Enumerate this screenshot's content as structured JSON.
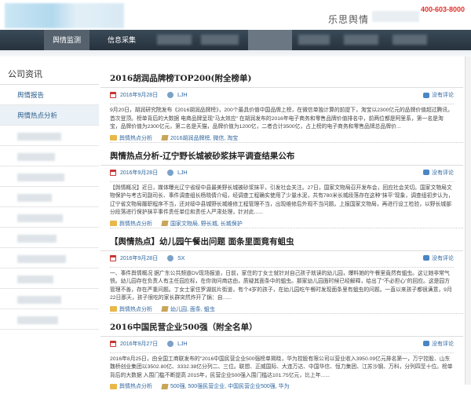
{
  "header": {
    "phone": "400-603-8000",
    "brand": "乐思舆情"
  },
  "nav": {
    "items": [
      {
        "label": "舆情监测"
      },
      {
        "label": "信息采集"
      }
    ]
  },
  "sidebar": {
    "title": "公司资讯",
    "items": [
      {
        "label": "舆情报告"
      },
      {
        "label": "舆情热点分析"
      }
    ]
  },
  "articles": [
    {
      "title": "2016胡润品牌榜TOP200(附全榜单)",
      "date": "2016年9月28日",
      "author": "LJH",
      "comments": "没有评论",
      "summary": "9月20日，胡润研究院发布《2016胡润品牌榜》，200个最具价值中国品牌上榜，在微信单独计算的前提下，淘宝以2300亿元的品牌价值超过腾讯，首次登顶。榜单背后的大数据 电商品牌呈现\"马太效应\" 在胡润发布的2016年电子商务和零售品牌价值排名中，前两位都是阿里系，第一名是淘宝，品牌价值为2300亿元，第二名是天猫，品牌价值为1200亿，二者合计3500亿，占上榜的电子商务和零售品牌总品牌价...",
      "category": "舆情热点分析",
      "tags": "2016胡润品牌榜, 微信, 淘宝"
    },
    {
      "title": "舆情热点分析-辽宁野长城被砂浆抹平调查结果公布",
      "date": "2016年9月28日",
      "author": "LJH",
      "comments": "没有评论",
      "summary": "【舆情概况】近日，媒体曝光辽宁省绥中县最美野长城被砂浆抹平，引发社会关注。27日，国家文物局召开发布会，回应社会关切。国家文物局文物保护与考古司副司长、事件调查组长杨晓倩介绍，经调查工程确实使用了少量水泥，共有780米长城段落存在这种\"抹平\"现象，调查组初步认为，辽宁省文物局履职程序不当，还对绥中县城野长城维修工程管理不当，出现维修后外观不当问题。上报国家文物局，再进行设工检验，以野长城部分段落进行保护抹平事件责任单位和责任人严肃处理，针对此......",
      "category": "舆情热点分析",
      "tags": "国家文物局, 野长城, 长城保护"
    },
    {
      "title": "【舆情热点】幼儿园午餐出问题 面条里面竟有蛆虫",
      "date": "2016年9月28日",
      "author": "SX",
      "comments": "没有评论",
      "summary": "一、事件舆情概况 据广东公共频道DV现场报道，日前，家住的丁女士就针对自己孩子就读的幼儿园，爆料她的午餐里竟然有蛆虫。这让她非常气愤。幼儿园存在负责人有主任园应标，在你询问商店由，质疑其面条中的蛆虫。那家幼儿园面时候已经解释，给出了\"不必担心\"的回应。这是园方管理不善，存在严重问题。丁女士家住罗湖前片街道，有个4岁的孩子，在幼儿园吃午餐时发现面条里有蛆虫的问题。一直以来孩子都很满意，9月22日那天，孩子很吃的家长群突然炸开了锅：自......",
      "category": "舆情热点分析",
      "tags": "幼儿园, 面条, 蛆虫"
    },
    {
      "title": "2016中国民营企业500强（附全名单）",
      "date": "2016年9月27日",
      "author": "LJH",
      "comments": "没有评论",
      "summary": "2016年8月25日，由全国工商联发布的\"2016中国民营企业500强榜单揭晓，华为控股有限公司以营业收入3950.09亿元排名第一，万宁控股、山东魏桥创业集团以3502.80亿、3332.38亿分列二、三位。联想、正威国际、大连万达、中国华信、恒力集团、江苏沙钢、万科，分列四至十位。榜单背后的大数据 入围门槛不断提高 2015年，民营企业500强入围门槛达101.75亿元，比上年......",
      "category": "舆情热点分析",
      "tags": "500强, 500强民营企业, 中国民营企业500强, 华为"
    }
  ],
  "colors": {
    "nav_bg": "#2b3742",
    "link": "#2e66a0",
    "phone": "#e0302a"
  }
}
